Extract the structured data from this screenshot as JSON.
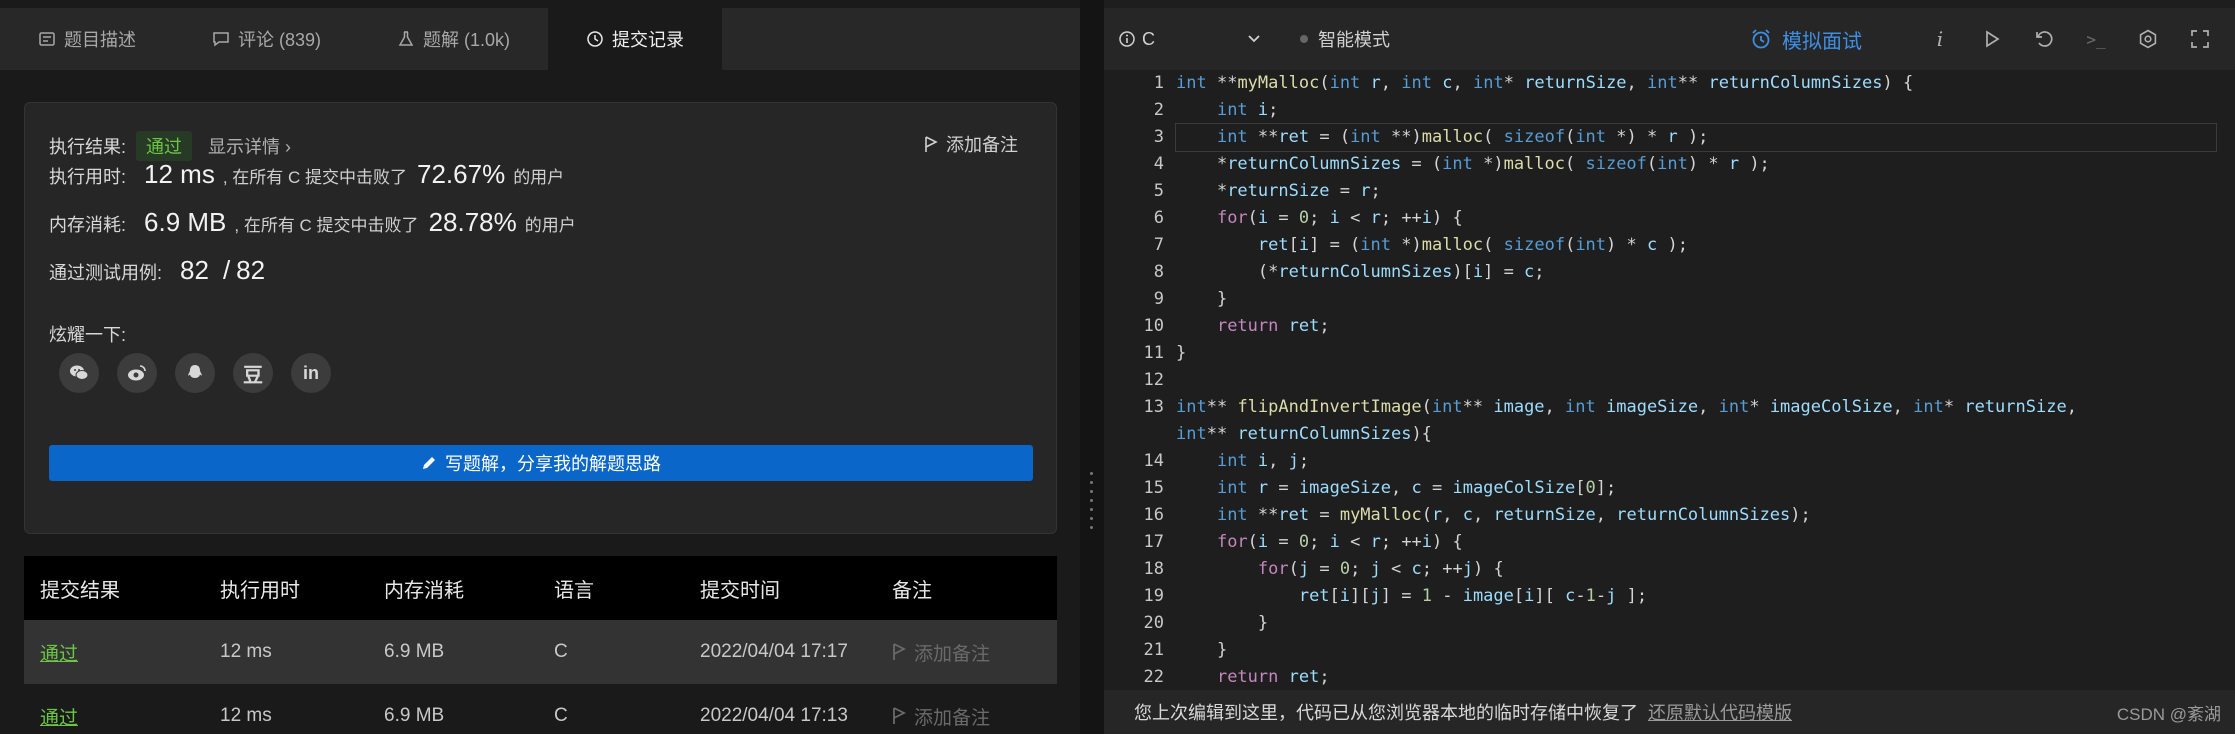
{
  "tabs": [
    {
      "label": "题目描述",
      "icon": "description-icon"
    },
    {
      "label": "评论 (839)",
      "icon": "comment-icon"
    },
    {
      "label": "题解 (1.0k)",
      "icon": "flask-icon"
    },
    {
      "label": "提交记录",
      "icon": "clock-icon"
    }
  ],
  "result": {
    "result_label": "执行结果:",
    "result_value": "通过",
    "detail_link": "显示详情",
    "add_note": "添加备注",
    "time_label": "执行用时:",
    "time_value": "12 ms",
    "time_desc": ", 在所有 C 提交中击败了",
    "time_pct": "72.67%",
    "time_suffix": "的用户",
    "mem_label": "内存消耗:",
    "mem_value": "6.9 MB",
    "mem_desc": ", 在所有 C 提交中击败了",
    "mem_pct": "28.78%",
    "mem_suffix": "的用户",
    "cases_label": "通过测试用例:",
    "cases_passed": "82",
    "cases_sep": "/",
    "cases_total": "82",
    "share_label": "炫耀一下:",
    "share_icons": [
      "wechat-icon",
      "weibo-icon",
      "qq-icon",
      "douban-icon",
      "linkedin-icon"
    ],
    "douban_glyph": "豆",
    "linkedin_glyph": "in",
    "write_button": "写题解，分享我的解题思路"
  },
  "table": {
    "headers": [
      "提交结果",
      "执行用时",
      "内存消耗",
      "语言",
      "提交时间",
      "备注"
    ],
    "rows": [
      {
        "result": "通过",
        "time": "12 ms",
        "memory": "6.9 MB",
        "lang": "C",
        "submitted": "2022/04/04 17:17",
        "note": "添加备注"
      },
      {
        "result": "通过",
        "time": "12 ms",
        "memory": "6.9 MB",
        "lang": "C",
        "submitted": "2022/04/04 17:13",
        "note": "添加备注"
      }
    ]
  },
  "toolbar": {
    "language": "C",
    "smart_mode": "智能模式",
    "mock_interview": "模拟面试",
    "info_glyph": "i",
    "terminal_glyph": ">_",
    "icons": [
      "info-icon",
      "run-icon",
      "reset-icon",
      "console-icon",
      "settings-icon",
      "fullscreen-icon"
    ],
    "accent": "#3d8fe6"
  },
  "editor": {
    "line_numbers": [
      "1",
      "2",
      "3",
      "4",
      "5",
      "6",
      "7",
      "8",
      "9",
      "10",
      "11",
      "12",
      "13",
      "",
      "14",
      "15",
      "16",
      "17",
      "18",
      "19",
      "20",
      "21",
      "22"
    ],
    "lines": [
      "int **myMalloc(int r, int c, int* returnSize, int** returnColumnSizes) {",
      "    int i;",
      "    int **ret = (int **)malloc( sizeof(int *) * r );",
      "    *returnColumnSizes = (int *)malloc( sizeof(int) * r );",
      "    *returnSize = r;",
      "    for(i = 0; i < r; ++i) {",
      "        ret[i] = (int *)malloc( sizeof(int) * c );",
      "        (*returnColumnSizes)[i] = c;",
      "    }",
      "    return ret;",
      "}",
      "",
      "int** flipAndInvertImage(int** image, int imageSize, int* imageColSize, int* returnSize,",
      "int** returnColumnSizes){",
      "    int i, j;",
      "    int r = imageSize, c = imageColSize[0];",
      "    int **ret = myMalloc(r, c, returnSize, returnColumnSizes);",
      "    for(i = 0; i < r; ++i) {",
      "        for(j = 0; j < c; ++j) {",
      "            ret[i][j] = 1 - image[i][ c-1-j ];",
      "        }",
      "    }",
      "    return ret;"
    ]
  },
  "restore": {
    "message": "您上次编辑到这里，代码已从您浏览器本地的临时存储中恢复了",
    "link": "还原默认代码模版"
  },
  "watermark": "CSDN @紊湖"
}
